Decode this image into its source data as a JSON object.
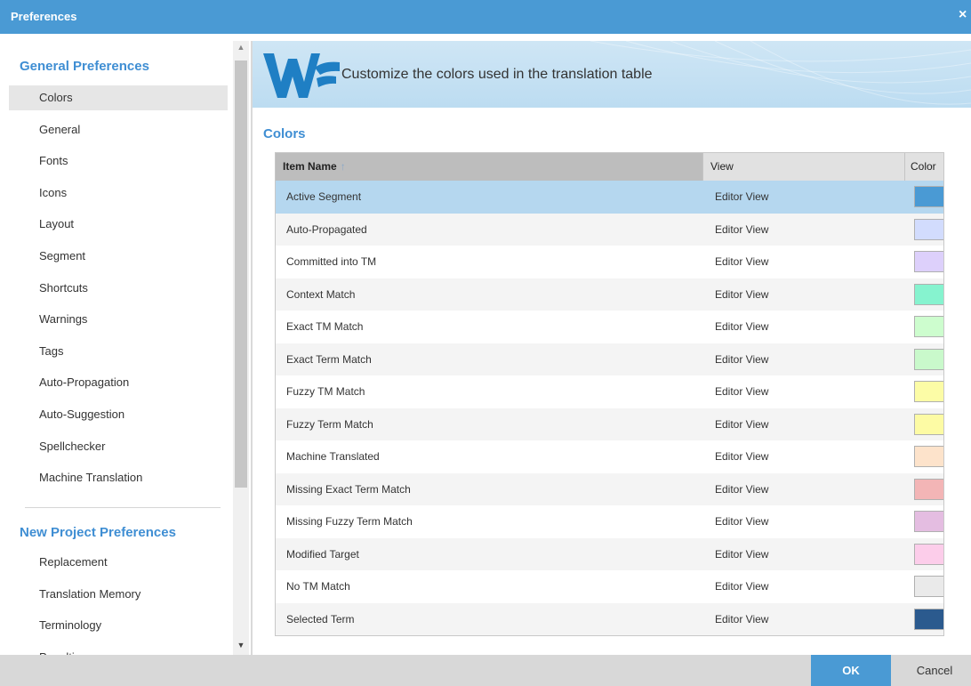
{
  "window": {
    "title": "Preferences",
    "close_label": "×"
  },
  "sidebar": {
    "general_title": "General Preferences",
    "general_items": [
      {
        "label": "Colors"
      },
      {
        "label": "General"
      },
      {
        "label": "Fonts"
      },
      {
        "label": "Icons"
      },
      {
        "label": "Layout"
      },
      {
        "label": "Segment"
      },
      {
        "label": "Shortcuts"
      },
      {
        "label": "Warnings"
      },
      {
        "label": "Tags"
      },
      {
        "label": "Auto-Propagation"
      },
      {
        "label": "Auto-Suggestion"
      },
      {
        "label": "Spellchecker"
      },
      {
        "label": "Machine Translation"
      }
    ],
    "selected_item": "Colors",
    "project_title": "New Project Preferences",
    "project_items": [
      {
        "label": "Replacement"
      },
      {
        "label": "Translation Memory"
      },
      {
        "label": "Terminology"
      },
      {
        "label": "Penalties"
      }
    ]
  },
  "banner": {
    "subtitle": "Customize the colors used in the translation table"
  },
  "main": {
    "heading": "Colors"
  },
  "table": {
    "headers": {
      "name": "Item Name",
      "view": "View",
      "color": "Color",
      "sort_glyph": "↑"
    },
    "rows": [
      {
        "name": "Active Segment",
        "view": "Editor View",
        "color": "#4a9ad4"
      },
      {
        "name": "Auto-Propagated",
        "view": "Editor View",
        "color": "#d2dcfd"
      },
      {
        "name": "Committed into TM",
        "view": "Editor View",
        "color": "#ddd0fb"
      },
      {
        "name": "Context Match",
        "view": "Editor View",
        "color": "#86f3cf"
      },
      {
        "name": "Exact TM Match",
        "view": "Editor View",
        "color": "#cdfdce"
      },
      {
        "name": "Exact Term Match",
        "view": "Editor View",
        "color": "#c9f9cb"
      },
      {
        "name": "Fuzzy TM Match",
        "view": "Editor View",
        "color": "#fcfca6"
      },
      {
        "name": "Fuzzy Term Match",
        "view": "Editor View",
        "color": "#fdfba4"
      },
      {
        "name": "Machine Translated",
        "view": "Editor View",
        "color": "#fde3cb"
      },
      {
        "name": "Missing Exact Term Match",
        "view": "Editor View",
        "color": "#f3b5b6"
      },
      {
        "name": "Missing Fuzzy Term Match",
        "view": "Editor View",
        "color": "#e4bde1"
      },
      {
        "name": "Modified Target",
        "view": "Editor View",
        "color": "#fccdea"
      },
      {
        "name": "No TM Match",
        "view": "Editor View",
        "color": "#eaeaea"
      },
      {
        "name": "Selected Term",
        "view": "Editor View",
        "color": "#2b5a8e"
      }
    ]
  },
  "footer": {
    "ok_label": "OK",
    "cancel_label": "Cancel"
  },
  "colors": {
    "accent": "#4a9ad4",
    "heading": "#3f8ed3"
  }
}
